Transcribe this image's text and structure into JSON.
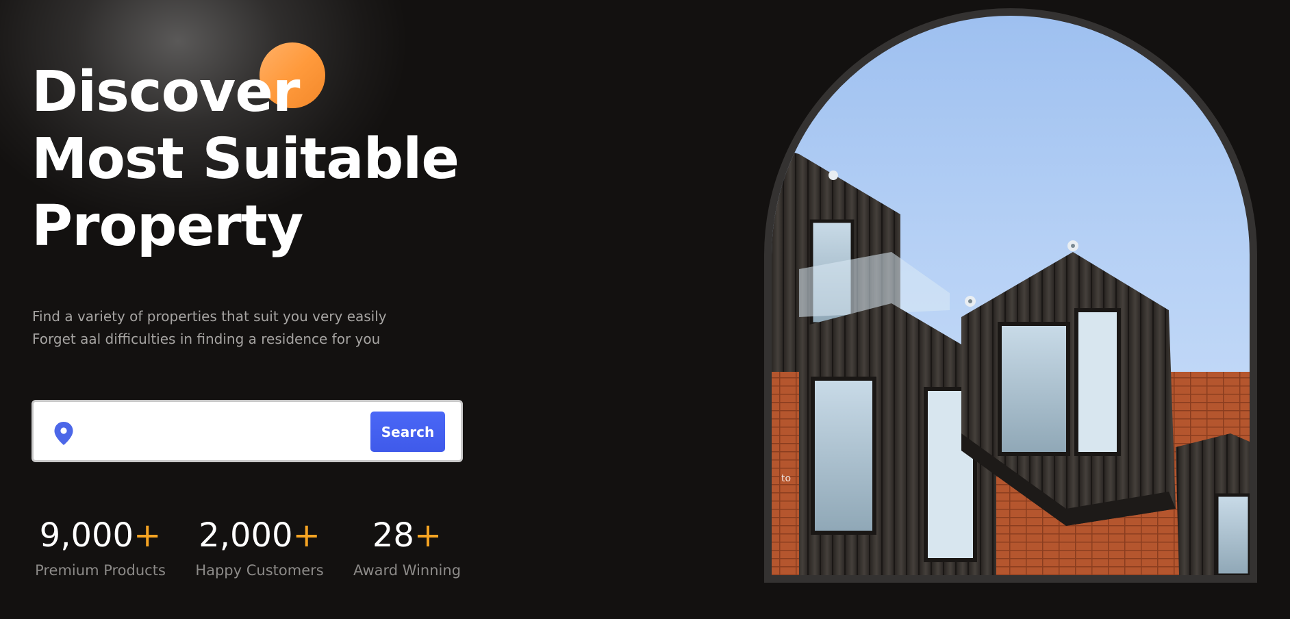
{
  "hero": {
    "title_lines": [
      "Discover",
      "Most Suitable",
      "Property"
    ],
    "subtitle_lines": [
      "Find a variety of properties that suit you very easily",
      "Forget aal difficulties in finding a residence for you"
    ]
  },
  "search": {
    "placeholder": "",
    "value": "",
    "button_label": "Search",
    "icon": "location-pin-icon"
  },
  "stats": [
    {
      "value": "9,000",
      "suffix": "+",
      "label": "Premium Products"
    },
    {
      "value": "2,000",
      "suffix": "+",
      "label": "Happy Customers"
    },
    {
      "value": "28",
      "suffix": "+",
      "label": "Award Winning"
    }
  ],
  "image": {
    "overlay_text": "to"
  },
  "colors": {
    "background": "#131110",
    "accent_orange": "#f6a423",
    "button_blue": "#4a67f6",
    "pin_blue": "#4c67e8"
  }
}
